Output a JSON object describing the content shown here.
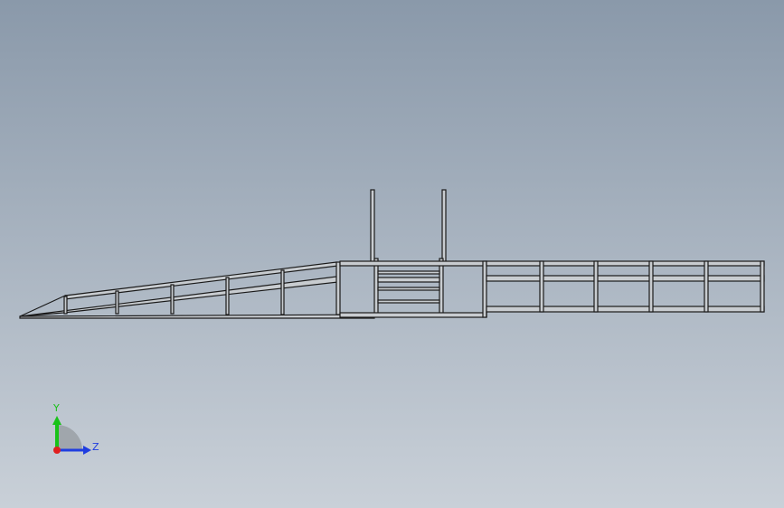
{
  "viewport": {
    "background_top": "#8a99aa",
    "background_bottom": "#c9d0d8",
    "model_stroke": "#1a1a1a",
    "model_fill": "#c8ccd0"
  },
  "triad": {
    "y_label": "Y",
    "z_label": "Z",
    "y_color": "#19c219",
    "z_color": "#1f3de0",
    "x_color": "#e01f1f",
    "icon": "coordinate-triad-icon"
  }
}
